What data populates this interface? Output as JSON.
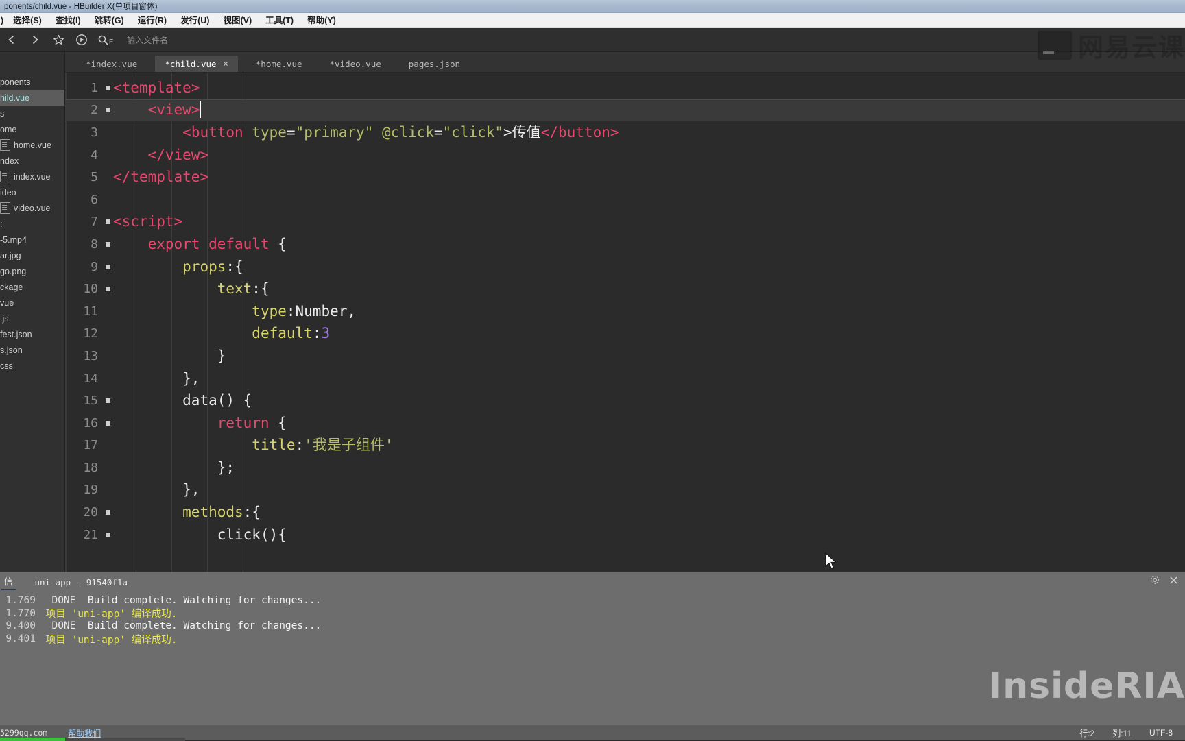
{
  "window": {
    "title": "ponents/child.vue - HBuilder X(单项目窗体)"
  },
  "menubar": {
    "items": [
      {
        "label": ")"
      },
      {
        "label": "选择(S)"
      },
      {
        "label": "查找(I)"
      },
      {
        "label": "跳转(G)"
      },
      {
        "label": "运行(R)"
      },
      {
        "label": "发行(U)"
      },
      {
        "label": "视图(V)"
      },
      {
        "label": "工具(T)"
      },
      {
        "label": "帮助(Y)"
      }
    ]
  },
  "toolbar": {
    "back_icon": "chevron-left-icon",
    "forward_icon": "chevron-right-icon",
    "favorite_icon": "star-icon",
    "run_icon": "play-circle-icon",
    "search_icon": "search-icon",
    "search_modifier": "F",
    "file_input_placeholder": "输入文件名",
    "watermark": "网易云课"
  },
  "sidebar": {
    "items": [
      {
        "label": "ponents",
        "type": "folder",
        "selected": false
      },
      {
        "label": "hild.vue",
        "type": "file-plain",
        "selected": true
      },
      {
        "label": "s",
        "type": "folder",
        "selected": false
      },
      {
        "label": "ome",
        "type": "folder",
        "selected": false
      },
      {
        "label": "home.vue",
        "type": "file",
        "selected": false
      },
      {
        "label": "ndex",
        "type": "folder",
        "selected": false
      },
      {
        "label": "index.vue",
        "type": "file",
        "selected": false
      },
      {
        "label": "ideo",
        "type": "folder",
        "selected": false
      },
      {
        "label": "video.vue",
        "type": "file",
        "selected": false
      },
      {
        "label": ":",
        "type": "folder",
        "selected": false
      },
      {
        "label": "-5.mp4",
        "type": "file-plain",
        "selected": false
      },
      {
        "label": "ar.jpg",
        "type": "file-plain",
        "selected": false
      },
      {
        "label": "go.png",
        "type": "file-plain",
        "selected": false
      },
      {
        "label": "ckage",
        "type": "file-plain",
        "selected": false
      },
      {
        "label": "vue",
        "type": "file-plain",
        "selected": false
      },
      {
        "label": ".js",
        "type": "file-plain",
        "selected": false
      },
      {
        "label": "fest.json",
        "type": "file-plain",
        "selected": false
      },
      {
        "label": "s.json",
        "type": "file-plain",
        "selected": false
      },
      {
        "label": "css",
        "type": "file-plain",
        "selected": false
      }
    ]
  },
  "tabs": [
    {
      "label": "*index.vue",
      "active": false,
      "closable": false
    },
    {
      "label": "*child.vue",
      "active": true,
      "closable": true,
      "close_label": "×"
    },
    {
      "label": "*home.vue",
      "active": false,
      "closable": false
    },
    {
      "label": "*video.vue",
      "active": false,
      "closable": false
    },
    {
      "label": "pages.json",
      "active": false,
      "closable": false
    }
  ],
  "editor": {
    "lines": [
      {
        "no": "1",
        "fold": true,
        "current": false,
        "tokens": [
          {
            "t": "<",
            "c": "tag"
          },
          {
            "t": "template",
            "c": "tag"
          },
          {
            "t": ">",
            "c": "tag"
          }
        ]
      },
      {
        "no": "2",
        "fold": true,
        "current": true,
        "tokens": [
          {
            "t": "    ",
            "c": "plain"
          },
          {
            "t": "<",
            "c": "tag"
          },
          {
            "t": "view",
            "c": "tag"
          },
          {
            "t": ">",
            "c": "tag"
          }
        ]
      },
      {
        "no": "3",
        "fold": false,
        "current": false,
        "tokens": [
          {
            "t": "        ",
            "c": "plain"
          },
          {
            "t": "<",
            "c": "tag"
          },
          {
            "t": "button",
            "c": "tag"
          },
          {
            "t": " ",
            "c": "plain"
          },
          {
            "t": "type",
            "c": "attr"
          },
          {
            "t": "=",
            "c": "plain"
          },
          {
            "t": "\"primary\"",
            "c": "str"
          },
          {
            "t": " ",
            "c": "plain"
          },
          {
            "t": "@click",
            "c": "attr"
          },
          {
            "t": "=",
            "c": "plain"
          },
          {
            "t": "\"click\"",
            "c": "str"
          },
          {
            "t": ">",
            "c": "plain"
          },
          {
            "t": "传值",
            "c": "plain"
          },
          {
            "t": "</",
            "c": "tag"
          },
          {
            "t": "button",
            "c": "tag"
          },
          {
            "t": ">",
            "c": "tag"
          }
        ]
      },
      {
        "no": "4",
        "fold": false,
        "current": false,
        "tokens": [
          {
            "t": "    ",
            "c": "plain"
          },
          {
            "t": "</",
            "c": "tag"
          },
          {
            "t": "view",
            "c": "tag"
          },
          {
            "t": ">",
            "c": "tag"
          }
        ]
      },
      {
        "no": "5",
        "fold": false,
        "current": false,
        "tokens": [
          {
            "t": "</",
            "c": "tag"
          },
          {
            "t": "template",
            "c": "tag"
          },
          {
            "t": ">",
            "c": "tag"
          }
        ]
      },
      {
        "no": "6",
        "fold": false,
        "current": false,
        "tokens": []
      },
      {
        "no": "7",
        "fold": true,
        "current": false,
        "tokens": [
          {
            "t": "<",
            "c": "tag"
          },
          {
            "t": "script",
            "c": "tag"
          },
          {
            "t": ">",
            "c": "tag"
          }
        ]
      },
      {
        "no": "8",
        "fold": true,
        "current": false,
        "tokens": [
          {
            "t": "    ",
            "c": "plain"
          },
          {
            "t": "export default",
            "c": "kw"
          },
          {
            "t": " {",
            "c": "plain"
          }
        ]
      },
      {
        "no": "9",
        "fold": true,
        "current": false,
        "tokens": [
          {
            "t": "        ",
            "c": "plain"
          },
          {
            "t": "props",
            "c": "key"
          },
          {
            "t": ":{",
            "c": "plain"
          }
        ]
      },
      {
        "no": "10",
        "fold": true,
        "current": false,
        "tokens": [
          {
            "t": "            ",
            "c": "plain"
          },
          {
            "t": "text",
            "c": "key"
          },
          {
            "t": ":{",
            "c": "plain"
          }
        ]
      },
      {
        "no": "11",
        "fold": false,
        "current": false,
        "tokens": [
          {
            "t": "                ",
            "c": "plain"
          },
          {
            "t": "type",
            "c": "key"
          },
          {
            "t": ":Number,",
            "c": "plain"
          }
        ]
      },
      {
        "no": "12",
        "fold": false,
        "current": false,
        "tokens": [
          {
            "t": "                ",
            "c": "plain"
          },
          {
            "t": "default",
            "c": "key"
          },
          {
            "t": ":",
            "c": "plain"
          },
          {
            "t": "3",
            "c": "num"
          }
        ]
      },
      {
        "no": "13",
        "fold": false,
        "current": false,
        "tokens": [
          {
            "t": "            }",
            "c": "plain"
          }
        ]
      },
      {
        "no": "14",
        "fold": false,
        "current": false,
        "tokens": [
          {
            "t": "        },",
            "c": "plain"
          }
        ]
      },
      {
        "no": "15",
        "fold": true,
        "current": false,
        "tokens": [
          {
            "t": "        ",
            "c": "plain"
          },
          {
            "t": "data() {",
            "c": "plain"
          }
        ]
      },
      {
        "no": "16",
        "fold": true,
        "current": false,
        "tokens": [
          {
            "t": "            ",
            "c": "plain"
          },
          {
            "t": "return",
            "c": "kw"
          },
          {
            "t": " {",
            "c": "plain"
          }
        ]
      },
      {
        "no": "17",
        "fold": false,
        "current": false,
        "tokens": [
          {
            "t": "                ",
            "c": "plain"
          },
          {
            "t": "title",
            "c": "key"
          },
          {
            "t": ":",
            "c": "plain"
          },
          {
            "t": "'我是子组件'",
            "c": "str"
          }
        ]
      },
      {
        "no": "18",
        "fold": false,
        "current": false,
        "tokens": [
          {
            "t": "            };",
            "c": "plain"
          }
        ]
      },
      {
        "no": "19",
        "fold": false,
        "current": false,
        "tokens": [
          {
            "t": "        },",
            "c": "plain"
          }
        ]
      },
      {
        "no": "20",
        "fold": true,
        "current": false,
        "tokens": [
          {
            "t": "        ",
            "c": "plain"
          },
          {
            "t": "methods",
            "c": "key"
          },
          {
            "t": ":{",
            "c": "plain"
          }
        ]
      },
      {
        "no": "21",
        "fold": true,
        "current": false,
        "tokens": [
          {
            "t": "            ",
            "c": "plain"
          },
          {
            "t": "click(){",
            "c": "plain"
          }
        ]
      }
    ]
  },
  "console": {
    "tab_label": "信",
    "session_label": "uni-app - 91540f1a",
    "settings_icon": "gear-icon",
    "close_icon": "close-icon",
    "logs": [
      {
        "ts": "1.769",
        "level": "DONE",
        "message": "Build complete. Watching for changes...",
        "cn": false
      },
      {
        "ts": "1.770",
        "level": "",
        "message": "项目 'uni-app' 编译成功.",
        "cn": true
      },
      {
        "ts": "9.400",
        "level": "DONE",
        "message": "Build complete. Watching for changes...",
        "cn": false
      },
      {
        "ts": "9.401",
        "level": "",
        "message": "项目 'uni-app' 编译成功.",
        "cn": true
      }
    ],
    "watermark": "InsideRIA"
  },
  "statusbar": {
    "site": "5299qq.com",
    "help_link": "帮助我们",
    "line": "行:2",
    "column": "列:11",
    "encoding": "UTF-8"
  }
}
